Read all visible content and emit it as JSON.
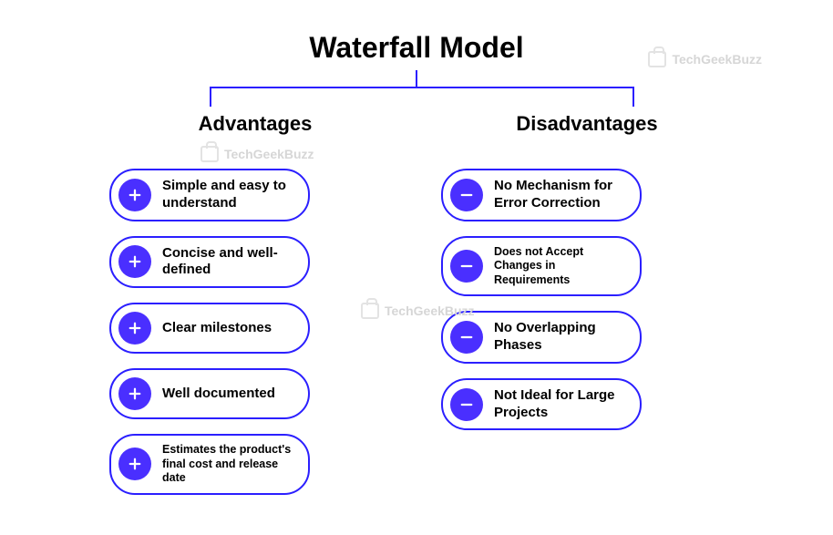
{
  "title": "Waterfall Model",
  "columns": {
    "advantages": {
      "title": "Advantages",
      "items": [
        {
          "text": "Simple and easy to understand",
          "small": false
        },
        {
          "text": "Concise and well-defined",
          "small": false
        },
        {
          "text": "Clear milestones",
          "small": false
        },
        {
          "text": "Well documented",
          "small": false
        },
        {
          "text": "Estimates the product's final cost and release date",
          "small": true
        }
      ]
    },
    "disadvantages": {
      "title": "Disadvantages",
      "items": [
        {
          "text": "No Mechanism for Error Correction",
          "small": false
        },
        {
          "text": "Does not Accept Changes in Requirements",
          "small": true
        },
        {
          "text": "No Overlapping Phases",
          "small": false
        },
        {
          "text": "Not Ideal for Large Projects",
          "small": false
        }
      ]
    }
  },
  "watermark": "TechGeekBuzz",
  "colors": {
    "accent": "#2b1fff",
    "icon_bg": "#4a2fff"
  }
}
